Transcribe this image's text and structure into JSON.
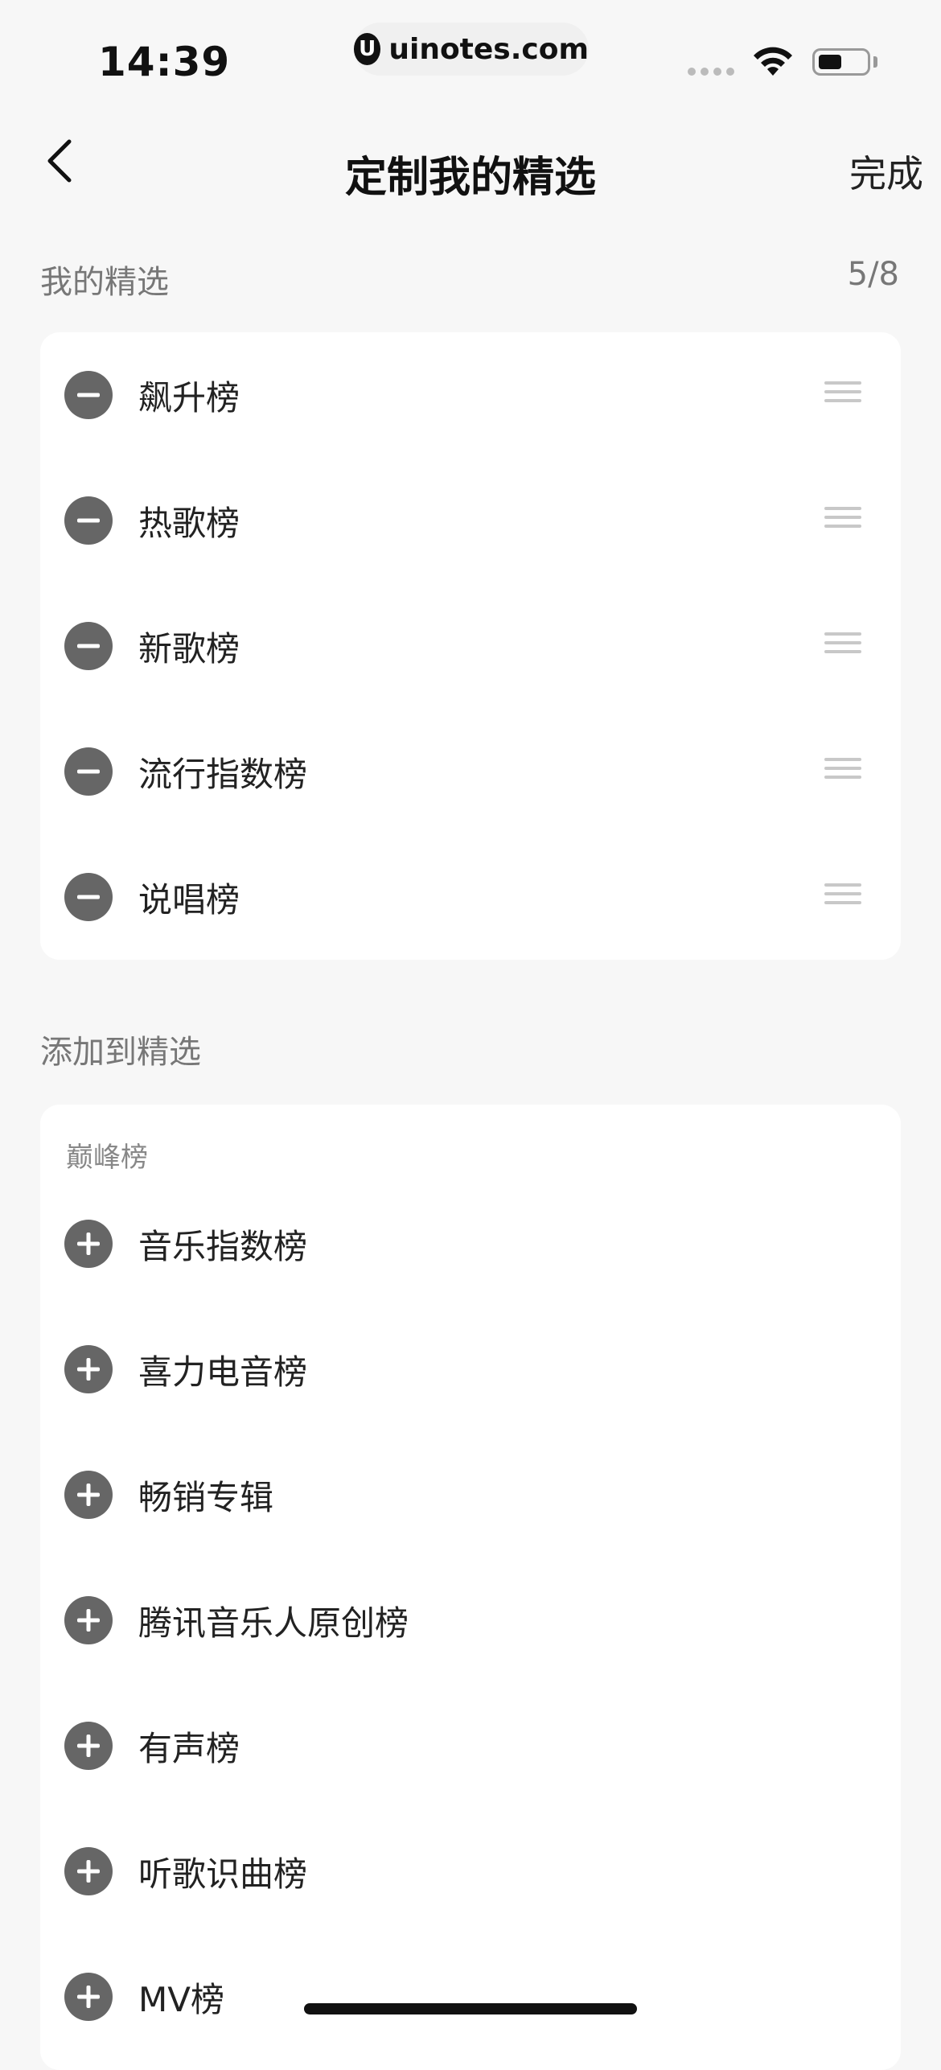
{
  "status_bar": {
    "time": "14:39",
    "url": "uinotes.com",
    "url_logo": "U"
  },
  "nav": {
    "back_icon": "chevron-left-icon",
    "title": "定制我的精选",
    "done_label": "完成"
  },
  "my_picks": {
    "title": "我的精选",
    "count": "5/8",
    "items": [
      {
        "label": "飙升榜"
      },
      {
        "label": "热歌榜"
      },
      {
        "label": "新歌榜"
      },
      {
        "label": "流行指数榜"
      },
      {
        "label": "说唱榜"
      }
    ]
  },
  "add_section": {
    "title": "添加到精选",
    "group_title": "巅峰榜",
    "items": [
      {
        "label": "音乐指数榜"
      },
      {
        "label": "喜力电音榜"
      },
      {
        "label": "畅销专辑"
      },
      {
        "label": "腾讯音乐人原创榜"
      },
      {
        "label": "有声榜"
      },
      {
        "label": "听歌识曲榜"
      },
      {
        "label": "MV榜"
      }
    ]
  },
  "colors": {
    "background": "#f7f7f7",
    "card": "#ffffff",
    "icon_circle": "#666666"
  }
}
